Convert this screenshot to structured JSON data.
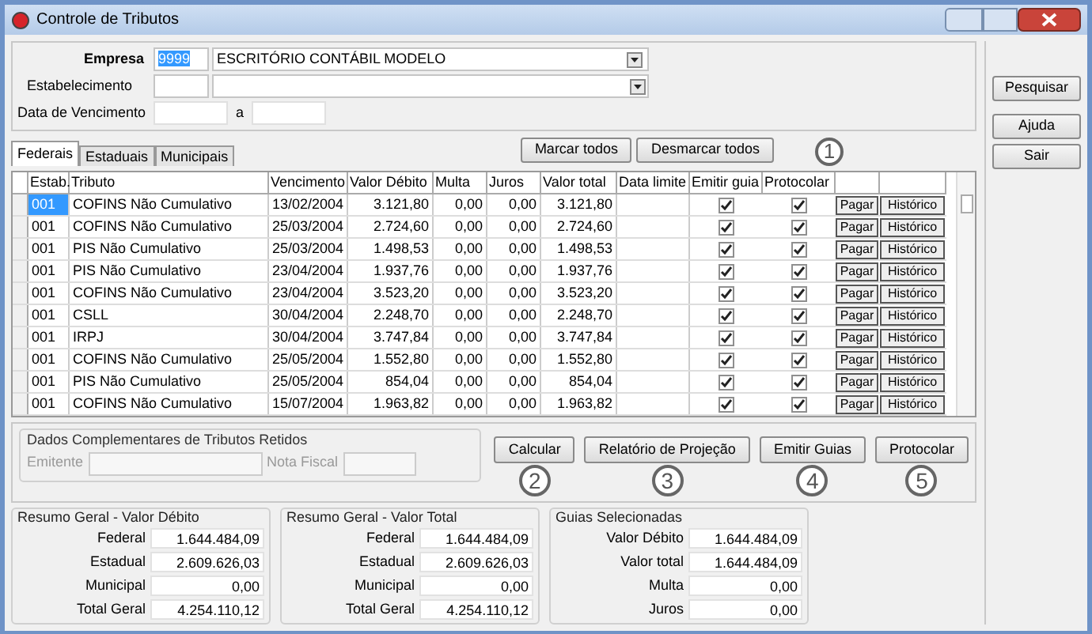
{
  "window": {
    "title": "Controle de Tributos"
  },
  "filters": {
    "empresa_label": "Empresa",
    "empresa_code": "9999",
    "empresa_name": "ESCRITÓRIO CONTÁBIL MODELO",
    "estabelecimento_label": "Estabelecimento",
    "vencimento_label": "Data de Vencimento",
    "range_separator": "a"
  },
  "side_buttons": [
    "Pesquisar",
    "Ajuda",
    "Sair"
  ],
  "tabs": [
    {
      "label": "Federais",
      "selected": true
    },
    {
      "label": "Estaduais",
      "selected": false
    },
    {
      "label": "Municipais",
      "selected": false
    }
  ],
  "mark_buttons": [
    "Marcar todos",
    "Desmarcar todos"
  ],
  "table": {
    "columns": [
      "Estab.",
      "Tributo",
      "Vencimento",
      "Valor Débito",
      "Multa",
      "Juros",
      "Valor total",
      "Data limite",
      "Emitir guia",
      "Protocolar"
    ],
    "callout": "1",
    "rows": [
      {
        "estab": "001",
        "tributo": "COFINS Não Cumulativo",
        "vencimento": "13/02/2004",
        "valor_debito": "3.121,80",
        "multa": "0,00",
        "juros": "0,00",
        "valor_total": "3.121,80",
        "emitir_guia": true,
        "protocolar": true,
        "pay": "Pagar",
        "history": "Histórico",
        "selected": true
      },
      {
        "estab": "001",
        "tributo": "COFINS Não Cumulativo",
        "vencimento": "25/03/2004",
        "valor_debito": "2.724,60",
        "multa": "0,00",
        "juros": "0,00",
        "valor_total": "2.724,60",
        "emitir_guia": true,
        "protocolar": true,
        "pay": "Pagar",
        "history": "Histórico",
        "selected": false
      },
      {
        "estab": "001",
        "tributo": "PIS Não Cumulativo",
        "vencimento": "25/03/2004",
        "valor_debito": "1.498,53",
        "multa": "0,00",
        "juros": "0,00",
        "valor_total": "1.498,53",
        "emitir_guia": true,
        "protocolar": true,
        "pay": "Pagar",
        "history": "Histórico",
        "selected": false
      },
      {
        "estab": "001",
        "tributo": "PIS Não Cumulativo",
        "vencimento": "23/04/2004",
        "valor_debito": "1.937,76",
        "multa": "0,00",
        "juros": "0,00",
        "valor_total": "1.937,76",
        "emitir_guia": true,
        "protocolar": true,
        "pay": "Pagar",
        "history": "Histórico",
        "selected": false
      },
      {
        "estab": "001",
        "tributo": "COFINS Não Cumulativo",
        "vencimento": "23/04/2004",
        "valor_debito": "3.523,20",
        "multa": "0,00",
        "juros": "0,00",
        "valor_total": "3.523,20",
        "emitir_guia": true,
        "protocolar": true,
        "pay": "Pagar",
        "history": "Histórico",
        "selected": false
      },
      {
        "estab": "001",
        "tributo": "CSLL",
        "vencimento": "30/04/2004",
        "valor_debito": "2.248,70",
        "multa": "0,00",
        "juros": "0,00",
        "valor_total": "2.248,70",
        "emitir_guia": true,
        "protocolar": true,
        "pay": "Pagar",
        "history": "Histórico",
        "selected": false
      },
      {
        "estab": "001",
        "tributo": "IRPJ",
        "vencimento": "30/04/2004",
        "valor_debito": "3.747,84",
        "multa": "0,00",
        "juros": "0,00",
        "valor_total": "3.747,84",
        "emitir_guia": true,
        "protocolar": true,
        "pay": "Pagar",
        "history": "Histórico",
        "selected": false
      },
      {
        "estab": "001",
        "tributo": "COFINS Não Cumulativo",
        "vencimento": "25/05/2004",
        "valor_debito": "1.552,80",
        "multa": "0,00",
        "juros": "0,00",
        "valor_total": "1.552,80",
        "emitir_guia": true,
        "protocolar": true,
        "pay": "Pagar",
        "history": "Histórico",
        "selected": false
      },
      {
        "estab": "001",
        "tributo": "PIS Não Cumulativo",
        "vencimento": "25/05/2004",
        "valor_debito": "854,04",
        "multa": "0,00",
        "juros": "0,00",
        "valor_total": "854,04",
        "emitir_guia": true,
        "protocolar": true,
        "pay": "Pagar",
        "history": "Histórico",
        "selected": false
      },
      {
        "estab": "001",
        "tributo": "COFINS Não Cumulativo",
        "vencimento": "15/07/2004",
        "valor_debito": "1.963,82",
        "multa": "0,00",
        "juros": "0,00",
        "valor_total": "1.963,82",
        "emitir_guia": true,
        "protocolar": true,
        "pay": "Pagar",
        "history": "Histórico",
        "selected": false
      }
    ]
  },
  "retidos": {
    "title": "Dados Complementares de Tributos Retidos",
    "emitente_label": "Emitente",
    "nota_label": "Nota Fiscal",
    "disabled": true
  },
  "action_buttons": [
    {
      "label": "Calcular",
      "callout": "2"
    },
    {
      "label": "Relatório de Projeção",
      "callout": "3"
    },
    {
      "label": "Emitir Guias",
      "callout": "4"
    },
    {
      "label": "Protocolar",
      "callout": "5"
    }
  ],
  "summaries": [
    {
      "title": "Resumo Geral - Valor Débito",
      "rows": [
        {
          "label": "Federal",
          "value": "1.644.484,09"
        },
        {
          "label": "Estadual",
          "value": "2.609.626,03"
        },
        {
          "label": "Municipal",
          "value": "0,00"
        },
        {
          "label": "Total Geral",
          "value": "4.254.110,12"
        }
      ]
    },
    {
      "title": "Resumo Geral - Valor Total",
      "rows": [
        {
          "label": "Federal",
          "value": "1.644.484,09"
        },
        {
          "label": "Estadual",
          "value": "2.609.626,03"
        },
        {
          "label": "Municipal",
          "value": "0,00"
        },
        {
          "label": "Total Geral",
          "value": "4.254.110,12"
        }
      ]
    },
    {
      "title": "Guias Selecionadas",
      "rows": [
        {
          "label": "Valor Débito",
          "value": "1.644.484,09"
        },
        {
          "label": "Valor total",
          "value": "1.644.484,09"
        },
        {
          "label": "Multa",
          "value": "0,00"
        },
        {
          "label": "Juros",
          "value": "0,00"
        }
      ]
    }
  ]
}
